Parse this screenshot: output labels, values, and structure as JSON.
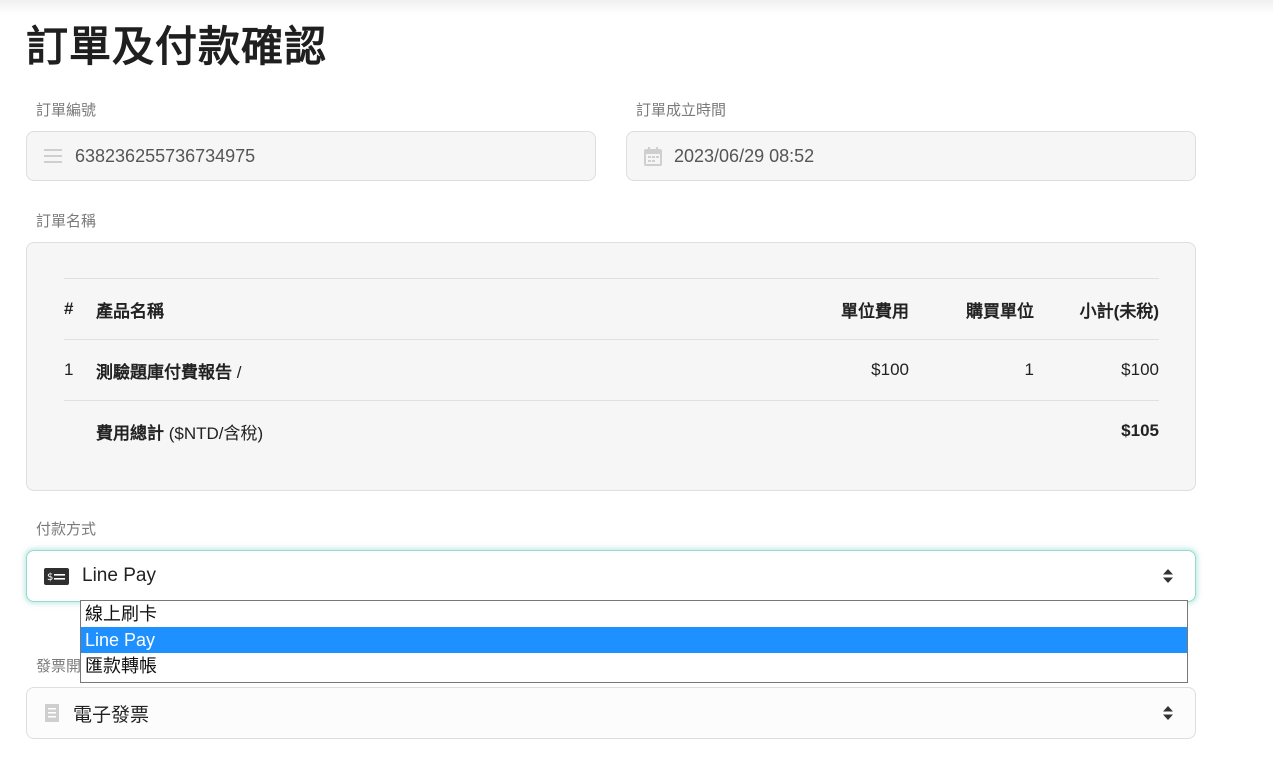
{
  "page": {
    "title": "訂單及付款確認"
  },
  "order": {
    "number_label": "訂單編號",
    "number_value": "638236255736734975",
    "time_label": "訂單成立時間",
    "time_value": "2023/06/29 08:52",
    "name_label": "訂單名稱"
  },
  "table": {
    "headers": {
      "num": "#",
      "product": "產品名稱",
      "unit_price": "單位費用",
      "qty": "購買單位",
      "subtotal": "小計(未稅)"
    },
    "rows": [
      {
        "num": "1",
        "product": "測驗題庫付費報告",
        "product_suffix": " /",
        "unit_price": "$100",
        "qty": "1",
        "subtotal": "$100"
      }
    ],
    "total": {
      "label": "費用總計",
      "label_note": " ($NTD/含稅)",
      "value": "$105"
    }
  },
  "payment": {
    "label": "付款方式",
    "selected": "Line Pay",
    "options": [
      "線上刷卡",
      "Line Pay",
      "匯款轉帳"
    ]
  },
  "invoice": {
    "label": "發票開",
    "selected": "電子發票"
  },
  "icons": {
    "number_field": "list-icon",
    "time_field": "calendar-icon",
    "payment_field": "money-icon",
    "invoice_field": "document-icon",
    "select_arrows": "updown-arrows-icon"
  },
  "colors": {
    "dropdown_selected_bg": "#1e90ff",
    "focus_glow": "#99d8d0"
  }
}
